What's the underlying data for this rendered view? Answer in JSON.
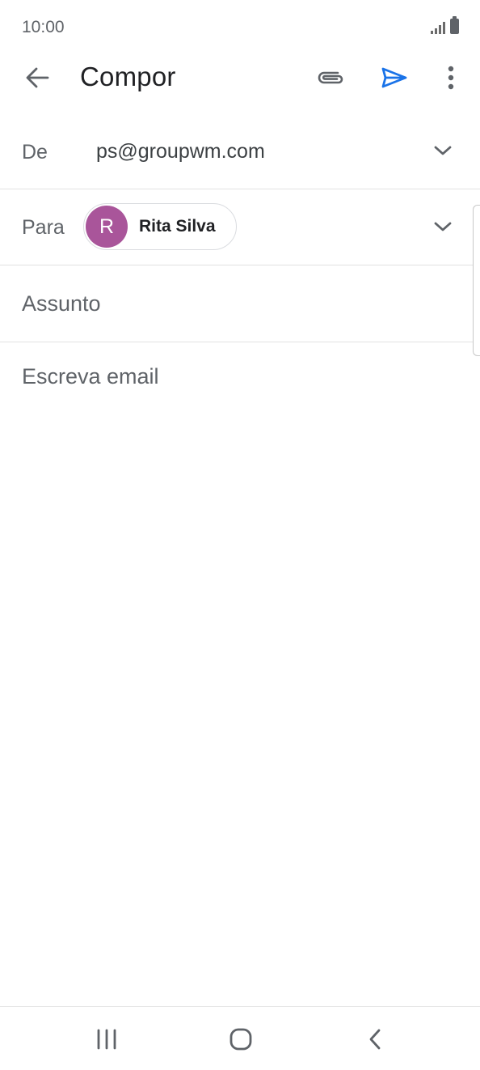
{
  "status_bar": {
    "time": "10:00",
    "icons": [
      "signal-icon",
      "battery-icon"
    ]
  },
  "app_bar": {
    "title": "Compor",
    "icons": [
      "back-arrow-icon",
      "paperclip-icon",
      "send-icon",
      "more-vert-icon"
    ],
    "send_color": "#1a73e8"
  },
  "compose": {
    "from_label": "De",
    "from_value": "ps@groupwm.com",
    "to_label": "Para",
    "recipient": {
      "initial": "R",
      "name": "Rita Silva",
      "avatar_color": "#a9559a"
    },
    "subject_placeholder": "Assunto",
    "body_placeholder": "Escreva email"
  },
  "nav_bar": {
    "icons": [
      "recents-icon",
      "home-icon",
      "back-chevron-icon"
    ]
  }
}
